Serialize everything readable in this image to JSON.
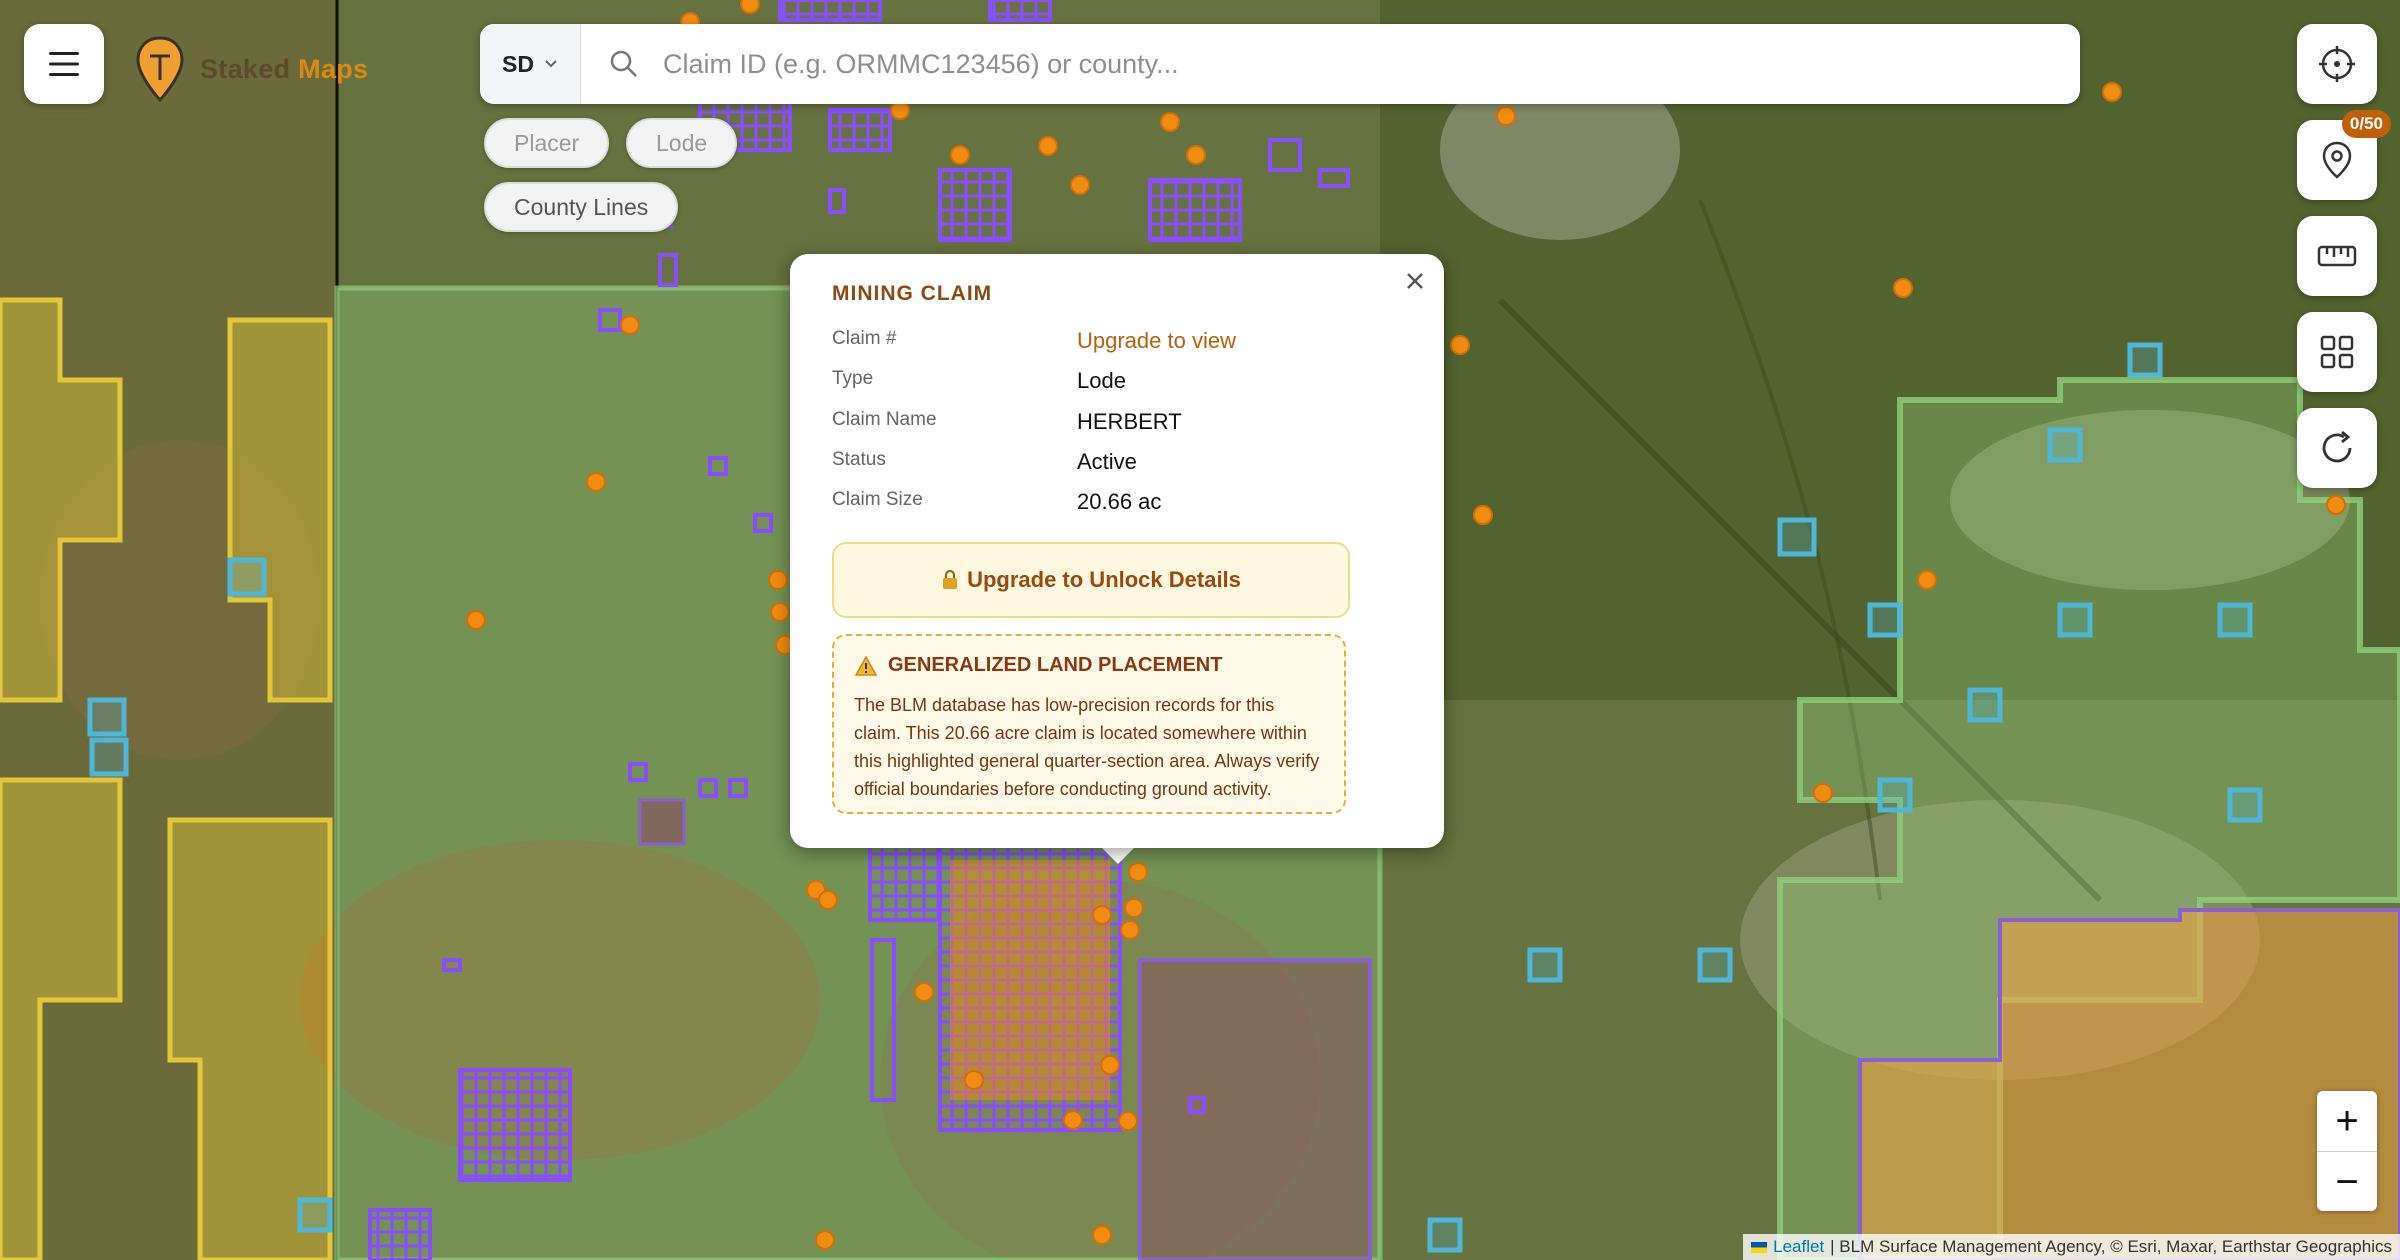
{
  "brand": {
    "name_part1": "Staked",
    "name_part2": "Maps"
  },
  "search": {
    "state": "SD",
    "placeholder": "Claim ID (e.g. ORMMC123456) or county..."
  },
  "filters": [
    {
      "label": "Placer",
      "active": false
    },
    {
      "label": "Lode",
      "active": false
    },
    {
      "label": "County Lines",
      "active": true
    }
  ],
  "right_controls": {
    "locate": "crosshair-icon",
    "pins_badge": "0/50",
    "pins": "pin-icon",
    "measure": "ruler-icon",
    "layers": "grid-icon",
    "refresh": "refresh-icon"
  },
  "zoom": {
    "in_label": "+",
    "out_label": "−"
  },
  "attribution": {
    "leaflet": "Leaflet",
    "text": "| BLM Surface Management Agency, © Esri, Maxar, Earthstar Geographics"
  },
  "popup": {
    "title": "MINING CLAIM",
    "rows": [
      {
        "label": "Claim #",
        "value": "Upgrade to view",
        "is_link": true
      },
      {
        "label": "Type",
        "value": "Lode"
      },
      {
        "label": "Claim Name",
        "value": "HERBERT"
      },
      {
        "label": "Status",
        "value": "Active"
      },
      {
        "label": "Claim Size",
        "value": "20.66 ac"
      }
    ],
    "unlock_label": "Upgrade to Unlock Details",
    "warning": {
      "title": "GENERALIZED LAND PLACEMENT",
      "body": "The BLM database has low-precision records for this claim. This 20.66 acre claim is located somewhere within this highlighted general quarter-section area. Always verify official boundaries before conducting ground activity."
    }
  },
  "colors": {
    "claim": "#7a3cff",
    "claim_point": "#f08c12",
    "blm": "#8fcf7a",
    "forest": "#e3c63a",
    "water": "#4fb6d6",
    "private": "#f5a040",
    "brand": "#d98a16"
  }
}
